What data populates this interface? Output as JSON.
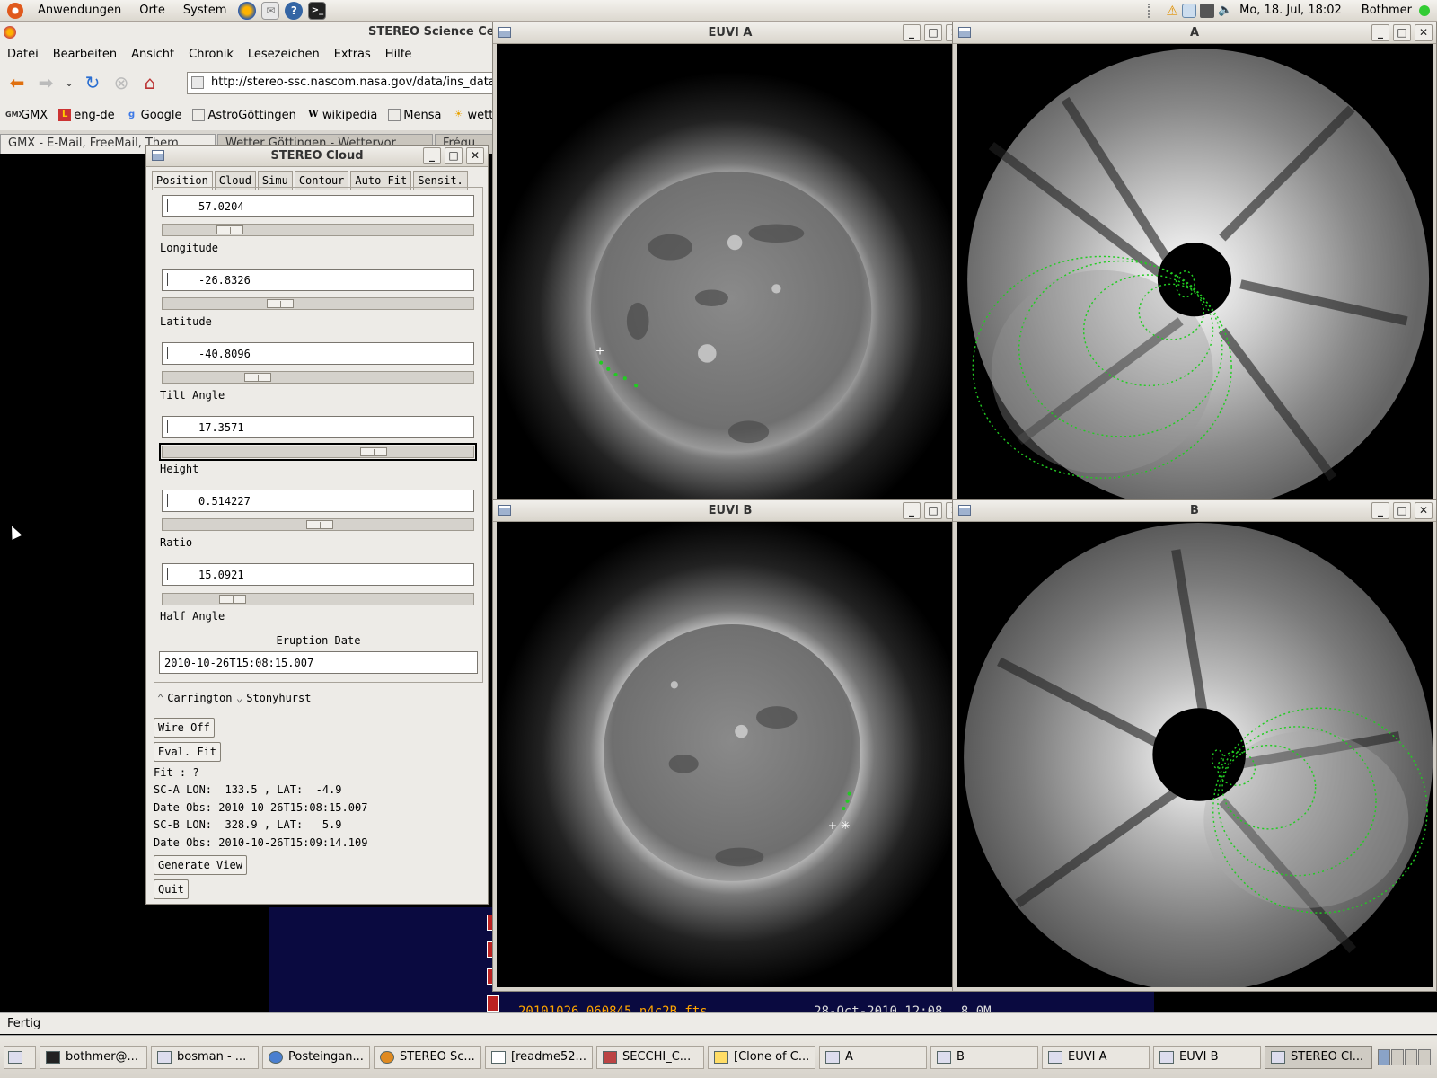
{
  "top_panel": {
    "menus": [
      "Anwendungen",
      "Orte",
      "System"
    ],
    "clock": "Mo, 18. Jul, 18:02",
    "user": "Bothmer"
  },
  "firefox": {
    "title": "STEREO Science Ce",
    "menu": [
      "Datei",
      "Bearbeiten",
      "Ansicht",
      "Chronik",
      "Lesezeichen",
      "Extras",
      "Hilfe"
    ],
    "url": "http://stereo-ssc.nascom.nasa.gov/data/ins_data/",
    "bookmarks": [
      "GMX",
      "eng-de",
      "Google",
      "AstroGöttingen",
      "wikipedia",
      "Mensa",
      "wetter"
    ],
    "tabs": [
      "GMX - E-Mail, FreeMail, Them...",
      "Wetter Göttingen - Wettervor...",
      "Fréqu"
    ],
    "status": "Fertig",
    "listing": {
      "file": "20101026_060845_n4c2B.fts",
      "date": "28-Oct-2010 12:08",
      "size": "8.0M"
    }
  },
  "cloud_dialog": {
    "title": "STEREO Cloud",
    "tabs": [
      "Position",
      "Cloud",
      "Simu",
      "Contour",
      "Auto Fit",
      "Sensit."
    ],
    "params": [
      {
        "label": "Longitude",
        "value": "57.0204",
        "slider_pos": 0.19
      },
      {
        "label": "Latitude",
        "value": "-26.8326",
        "slider_pos": 0.37
      },
      {
        "label": "Tilt Angle",
        "value": "-40.8096",
        "slider_pos": 0.29
      },
      {
        "label": "Height",
        "value": "17.3571",
        "slider_pos": 0.7
      },
      {
        "label": "Ratio",
        "value": "0.514227",
        "slider_pos": 0.51
      },
      {
        "label": "Half Angle",
        "value": "15.0921",
        "slider_pos": 0.2
      }
    ],
    "eruption_label": "Eruption Date",
    "eruption_date": "2010-10-26T15:08:15.007",
    "radio": {
      "carrington": "Carrington",
      "stonyhurst": "Stonyhurst"
    },
    "buttons": {
      "wire": "Wire Off",
      "eval": "Eval. Fit",
      "generate": "Generate View",
      "quit": "Quit"
    },
    "info": {
      "fit": "Fit : ?",
      "sca": "SC-A LON:  133.5 , LAT:  -4.9",
      "date_a": "Date Obs: 2010-10-26T15:08:15.007",
      "scb": "SC-B LON:  328.9 , LAT:   5.9",
      "date_b": "Date Obs: 2010-10-26T15:09:14.109"
    }
  },
  "image_windows": {
    "euvi_a": "EUVI A",
    "cor_a": "A",
    "euvi_b": "EUVI B",
    "cor_b": "B"
  },
  "taskbar": {
    "tasks": [
      "bothmer@...",
      "bosman - ...",
      "Posteingan...",
      "STEREO Sc...",
      "[readme52...",
      "SECCHI_C...",
      "[Clone of C...",
      "A",
      "B",
      "EUVI A",
      "EUVI B",
      "STEREO Cl..."
    ]
  },
  "colors": {
    "overlay": "#22cc22",
    "panel": "#edebe7"
  }
}
